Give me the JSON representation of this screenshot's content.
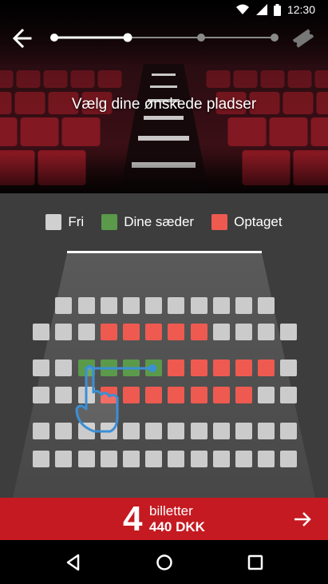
{
  "status": {
    "time": "12:30",
    "icons": [
      "wifi-icon",
      "signal-icon",
      "battery-icon"
    ]
  },
  "hero": {
    "title": "Vælg dine ønskede pladser"
  },
  "progress": {
    "steps": 4,
    "current_step": 2
  },
  "legend": [
    {
      "label": "Fri",
      "color": "#d0d0d0"
    },
    {
      "label": "Dine sæder",
      "color": "#5a9a4a"
    },
    {
      "label": "Optaget",
      "color": "#ee5a50"
    }
  ],
  "seatmap": {
    "rows": [
      "..FFFFFFFFFF..",
      ".FFFOOOOOFFFF.",
      "",
      ".FFSSSSOOOOOF.",
      ".FFFOOOOOOOFF.",
      "",
      ".FFFFFFFFFFFF.",
      ".FFFFFFFFFFFF."
    ],
    "colors": {
      "F": "#cbcbcb",
      "S": "#5a9a4a",
      "O": "#ee5a50"
    }
  },
  "footer": {
    "count": "4",
    "tickets_label": "billetter",
    "price": "440 DKK"
  },
  "icons": {
    "back": "arrow-left-icon",
    "ticket": "ticket-icon",
    "next": "arrow-right-icon"
  }
}
